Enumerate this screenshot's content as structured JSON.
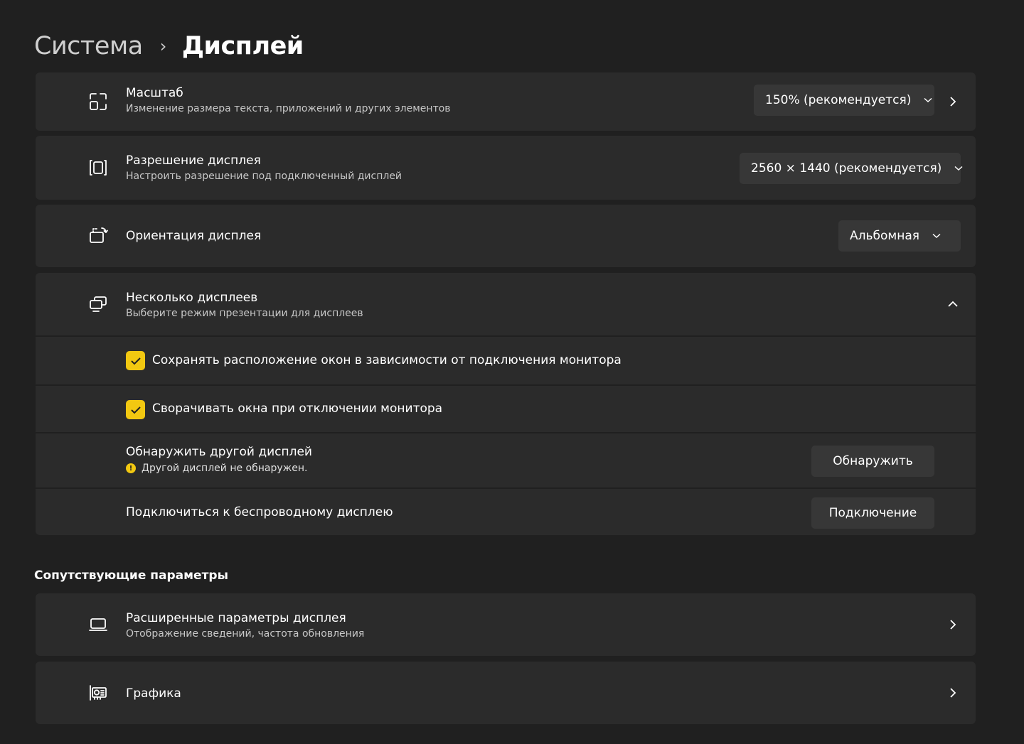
{
  "breadcrumb": {
    "parent": "Система",
    "separator": "›",
    "current": "Дисплей"
  },
  "scale": {
    "title": "Масштаб",
    "description": "Изменение размера текста, приложений и других элементов",
    "value": "150% (рекомендуется)",
    "icon": "scale-icon"
  },
  "resolution": {
    "title": "Разрешение дисплея",
    "description": "Настроить разрешение под подключенный дисплей",
    "value": "2560 × 1440 (рекомендуется)",
    "icon": "resolution-icon"
  },
  "orientation": {
    "title": "Ориентация дисплея",
    "value": "Альбомная",
    "icon": "orientation-icon"
  },
  "multiple_displays": {
    "title": "Несколько дисплеев",
    "description": "Выберите режим презентации для дисплеев",
    "icon": "multiple-displays-icon",
    "expanded": true,
    "options": {
      "remember_windows": {
        "label": "Сохранять расположение окон в зависимости от подключения монитора",
        "checked": true
      },
      "minimize_windows": {
        "label": "Сворачивать окна при отключении монитора",
        "checked": true
      }
    },
    "detect": {
      "title": "Обнаружить другой дисплей",
      "status": "Другой дисплей не обнаружен.",
      "button": "Обнаружить"
    },
    "wireless": {
      "title": "Подключиться к беспроводному дисплею",
      "button": "Подключение"
    }
  },
  "related": {
    "section_title": "Сопутствующие параметры",
    "advanced": {
      "title": "Расширенные параметры дисплея",
      "description": "Отображение сведений, частота обновления",
      "icon": "laptop-icon"
    },
    "graphics": {
      "title": "Графика",
      "icon": "graphics-card-icon"
    }
  },
  "colors": {
    "background": "#202020",
    "card": "#2b2b2b",
    "control": "#373737",
    "accent": "#f2c811"
  }
}
